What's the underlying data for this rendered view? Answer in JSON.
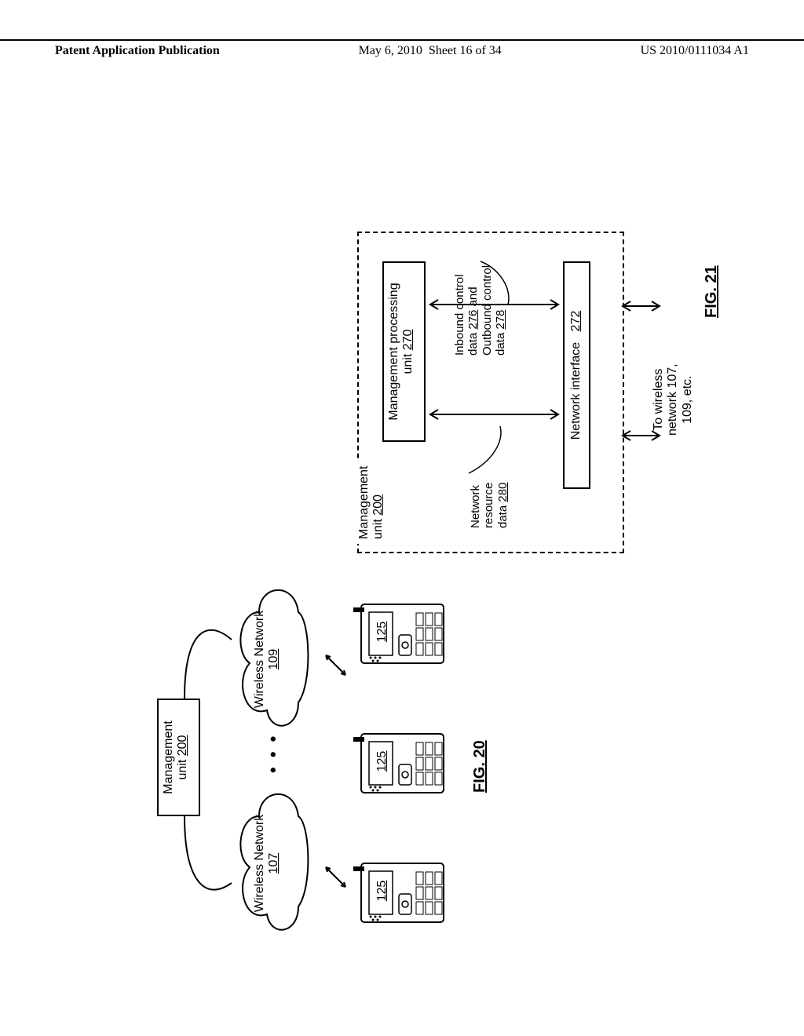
{
  "header": {
    "left": "Patent Application Publication",
    "center_date": "May 6, 2010",
    "center_sheet": "Sheet 16 of 34",
    "right": "US 2010/0111034 A1"
  },
  "fig20": {
    "caption": "FIG. 20",
    "mgmt_label": "Management",
    "mgmt_unit": "unit",
    "mgmt_num": "200",
    "cloud_label": "Wireless Network",
    "cloud1_num": "107",
    "cloud2_num": "109",
    "phone_num": "125",
    "dots": "• • •"
  },
  "fig21": {
    "caption": "FIG. 21",
    "box_label1": "Management",
    "box_label2": "unit",
    "box_num": "200",
    "mp_label": "Management processing",
    "mp_unit": "unit",
    "mp_num": "270",
    "ni_label": "Network interface",
    "ni_num": "272",
    "nrd_l1": "Network",
    "nrd_l2": "resource",
    "nrd_l3": "data",
    "nrd_num": "280",
    "ctrl_l1": "Inbound control",
    "ctrl_l2": "data",
    "ctrl_num1": "276",
    "ctrl_and": "and",
    "ctrl_l3": "Outbound control",
    "ctrl_l4": "data",
    "ctrl_num2": "278",
    "to_l1": "To wireless",
    "to_l2": "network 107,",
    "to_l3": "109, etc."
  }
}
